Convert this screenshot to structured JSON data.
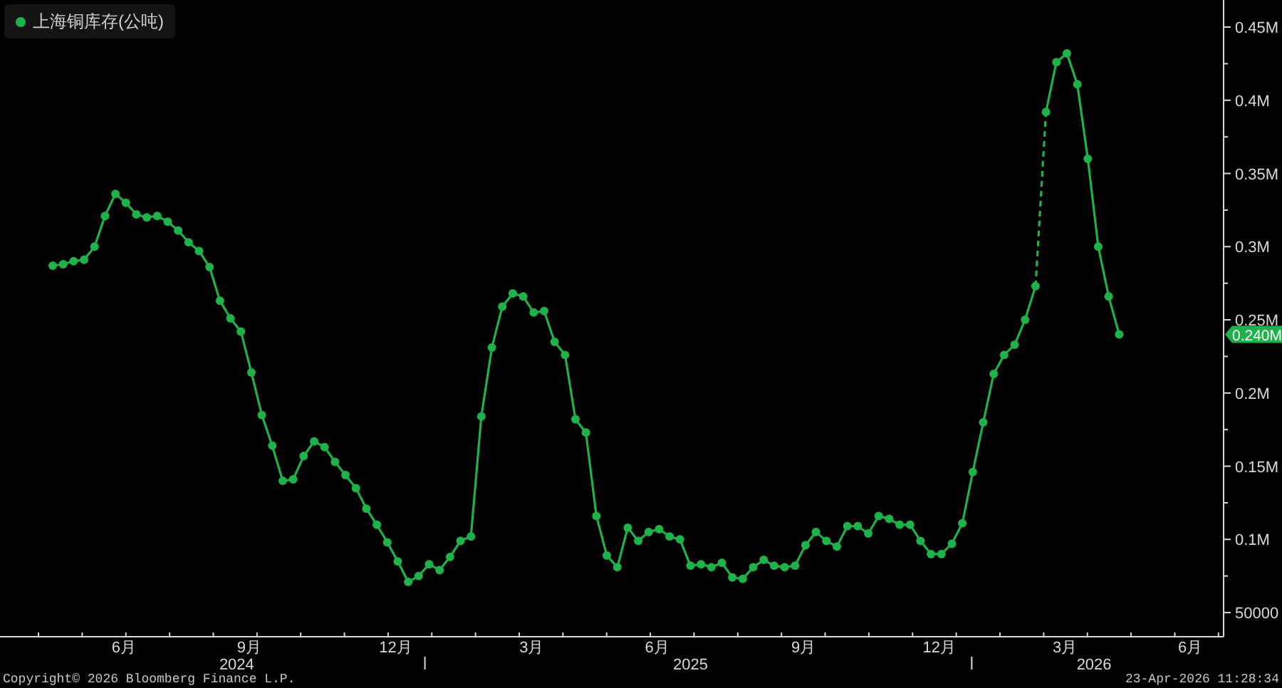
{
  "chart_data": {
    "type": "line",
    "categories": [
      null,
      null,
      null,
      null,
      null,
      null,
      null,
      "6月",
      null,
      null,
      null,
      null,
      null,
      null,
      null,
      null,
      null,
      null,
      null,
      "9月",
      null,
      null,
      null,
      null,
      null,
      null,
      null,
      null,
      null,
      null,
      null,
      null,
      null,
      "12月",
      null,
      null,
      null,
      null,
      null,
      null,
      null,
      null,
      null,
      null,
      null,
      null,
      "3月",
      null,
      null,
      null,
      null,
      null,
      null,
      null,
      null,
      null,
      null,
      null,
      "6月",
      null,
      null,
      null,
      null,
      null,
      null,
      null,
      null,
      null,
      null,
      null,
      null,
      null,
      "9月",
      null,
      null,
      null,
      null,
      null,
      null,
      null,
      null,
      null,
      null,
      null,
      null,
      "12月",
      null,
      null,
      null,
      null,
      null,
      null,
      null,
      null,
      null,
      null,
      null,
      "3月",
      null,
      null,
      null,
      null,
      null,
      null,
      null,
      null,
      null,
      null,
      null,
      "6月"
    ],
    "series": [
      {
        "name": "上海铜库存(公吨)",
        "color": "#1fb24a",
        "marker": "circle",
        "values": [
          287000,
          288000,
          290000,
          291000,
          300000,
          321000,
          336000,
          330000,
          322000,
          320000,
          321000,
          317000,
          311000,
          303000,
          297000,
          286000,
          263000,
          251000,
          242000,
          214000,
          185000,
          164000,
          140000,
          141000,
          157000,
          167000,
          163000,
          153000,
          144000,
          135000,
          121000,
          110000,
          98000,
          85000,
          71000,
          75000,
          83000,
          79000,
          88000,
          99000,
          102000,
          184000,
          231000,
          259000,
          268000,
          266000,
          255000,
          256000,
          235000,
          226000,
          182000,
          173000,
          116000,
          89000,
          81000,
          108000,
          99000,
          105000,
          107000,
          102000,
          100000,
          82000,
          83000,
          81000,
          84000,
          74000,
          73000,
          81000,
          86000,
          82000,
          81000,
          82000,
          96000,
          105000,
          99000,
          95000,
          109000,
          109000,
          104000,
          116000,
          114000,
          110000,
          110000,
          99000,
          90000,
          90000,
          97000,
          111000,
          146000,
          180000,
          213000,
          226000,
          233000,
          250000,
          273000,
          392000,
          426000,
          432000,
          411000,
          360000,
          300000,
          266000,
          240000,
          null,
          null,
          null,
          null,
          null,
          null,
          null
        ]
      }
    ],
    "ylim": [
      33500,
      468500
    ],
    "yticks": [
      {
        "value": 450000,
        "label": "0.45M"
      },
      {
        "value": 400000,
        "label": "0.4M"
      },
      {
        "value": 350000,
        "label": "0.35M"
      },
      {
        "value": 300000,
        "label": "0.3M"
      },
      {
        "value": 250000,
        "label": "0.25M"
      },
      {
        "value": 200000,
        "label": "0.2M"
      },
      {
        "value": 150000,
        "label": "0.15M"
      },
      {
        "value": 100000,
        "label": "0.1M"
      },
      {
        "value": 50000,
        "label": "50000"
      }
    ]
  },
  "year_labels": [
    "2024",
    "2025",
    "2026"
  ],
  "last_value_label": "0.240M",
  "footer": {
    "copyright": "Copyright© 2026 Bloomberg Finance L.P.",
    "timestamp": "23-Apr-2026 11:28:34"
  }
}
